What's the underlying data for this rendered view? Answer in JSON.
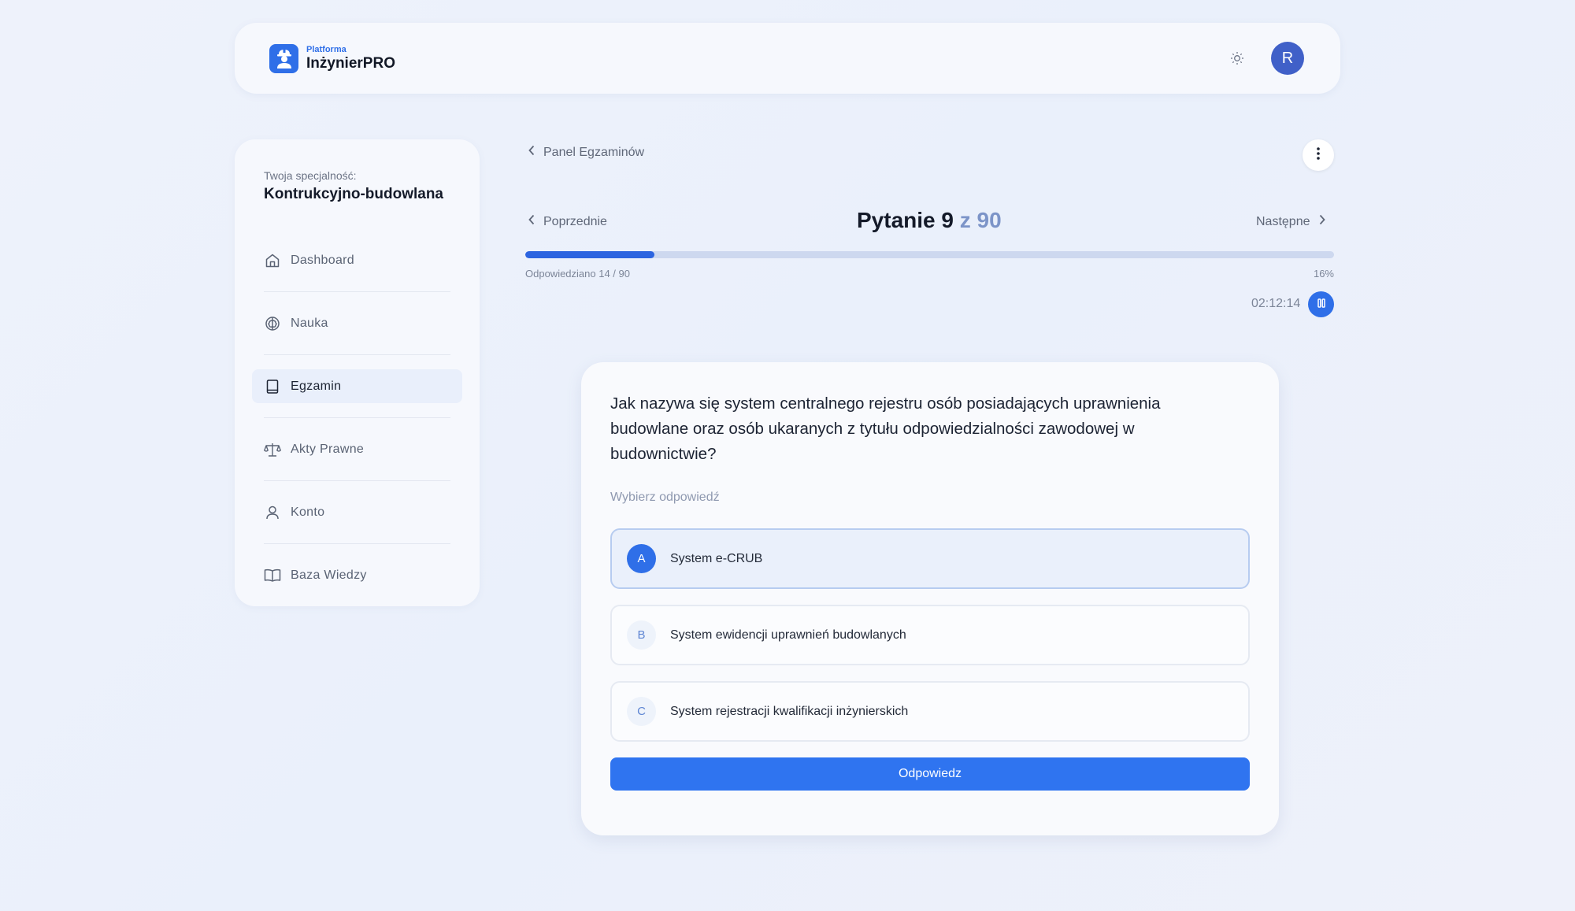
{
  "header": {
    "logo_small": "Platforma",
    "logo_big": "InżynierPRO",
    "theme_icon": "sun-icon",
    "avatar_initial": "R"
  },
  "sidebar": {
    "spec_label": "Twoja specjalność:",
    "spec_value": "Kontrukcyjno-budowlana",
    "items": [
      {
        "label": "Dashboard",
        "icon": "home-icon"
      },
      {
        "label": "Nauka",
        "icon": "brain-icon"
      },
      {
        "label": "Egzamin",
        "icon": "book-icon",
        "active": true
      },
      {
        "label": "Akty Prawne",
        "icon": "scale-icon"
      },
      {
        "label": "Konto",
        "icon": "user-icon"
      },
      {
        "label": "Baza Wiedzy",
        "icon": "open-book-icon"
      }
    ]
  },
  "main": {
    "back_label": "Panel Egzaminów",
    "prev_label": "Poprzednie",
    "next_label": "Następne",
    "question_title": "Pytanie 9",
    "question_of": "z 90",
    "progress_label": "Odpowiedziano 14 / 90",
    "progress_pct": "16%",
    "progress_value": 0.16,
    "timer": "02:12:14"
  },
  "card": {
    "question": "Jak nazywa się system centralnego rejestru osób posiadających uprawnienia budowlane oraz osób ukaranych z tytułu odpowiedzialności zawodowej w budownictwie?",
    "pick_label": "Wybierz odpowiedź",
    "options": [
      {
        "letter": "A",
        "text": "System e-CRUB",
        "selected": true
      },
      {
        "letter": "B",
        "text": "System ewidencji uprawnień budowlanych",
        "selected": false
      },
      {
        "letter": "C",
        "text": "System rejestracji kwalifikacji inżynierskich",
        "selected": false
      }
    ],
    "submit_label": "Odpowiedz"
  },
  "colors": {
    "accent": "#2f6fe8",
    "progress_track": "#cdd8ef",
    "avatar": "#4060c8"
  }
}
